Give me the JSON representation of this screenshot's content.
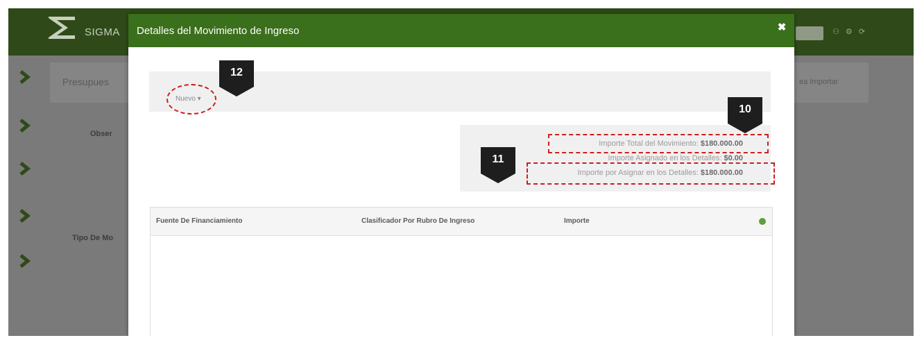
{
  "app": {
    "brand": "SIGMA",
    "top_icons": "⚇ ⚙ ⟳"
  },
  "background": {
    "panel_title": "Presupues",
    "panel_right": "ea Importar",
    "label_obser": "Obser",
    "label_tipo": "Tipo De Mo",
    "sidebar_icons": [
      "chevron-right-icon",
      "chevron-right-icon",
      "chevron-right-icon",
      "chevron-right-icon",
      "chevron-right-icon"
    ]
  },
  "modal": {
    "title": "Detalles del Movimiento de Ingreso",
    "close_label": "✖",
    "nuevo_label": "Nuevo ▾",
    "summary": {
      "total_label": "Importe Total del Movimiento:",
      "total_value": "$180.000.00",
      "asignado_label": "Importe Asignado en los Detalles:",
      "asignado_value": "$0.00",
      "por_asignar_label": "Importe por Asignar en los Detalles:",
      "por_asignar_value": "$180.000.00"
    },
    "table": {
      "columns": [
        "Fuente De Financiamiento",
        "Clasificador Por Rubro De Ingreso",
        "Importe"
      ],
      "rows": []
    }
  },
  "callouts": {
    "c10": "10",
    "c11": "11",
    "c12": "12"
  },
  "colors": {
    "header_green": "#3a6f1c",
    "topbar": "#2f4a18",
    "annotation_red": "#cc1e1e",
    "add_green": "#5f9e3a"
  }
}
